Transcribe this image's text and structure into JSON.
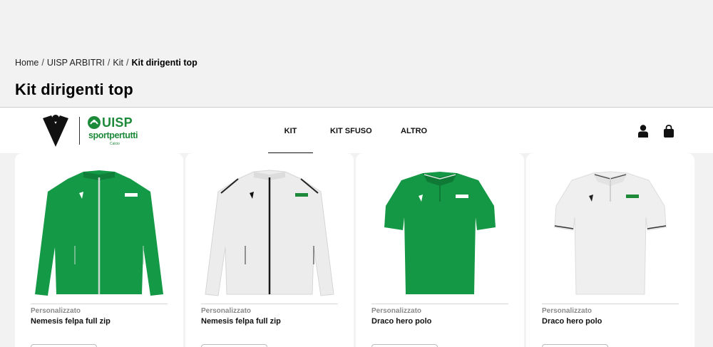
{
  "breadcrumb": {
    "items": [
      "Home",
      "UISP ARBITRI",
      "Kit"
    ],
    "separator": "/",
    "current": "Kit dirigenti top"
  },
  "page": {
    "title": "Kit dirigenti top"
  },
  "brand": {
    "uisp_word": "UISP",
    "uisp_tagline": "sportpertutti",
    "uisp_sub": "Calcio",
    "accent_green": "#1d8a3a"
  },
  "nav": {
    "items": [
      {
        "label": "KIT",
        "active": true
      },
      {
        "label": "KIT SFUSO",
        "active": false
      },
      {
        "label": "ALTRO",
        "active": false
      }
    ]
  },
  "header_icons": [
    "user-icon",
    "shopping-bag-icon"
  ],
  "products": [
    {
      "category": "Personalizzato",
      "name": "Nemesis felpa full zip",
      "color": "green",
      "type": "jacket"
    },
    {
      "category": "Personalizzato",
      "name": "Nemesis felpa full zip",
      "color": "white",
      "type": "jacket"
    },
    {
      "category": "Personalizzato",
      "name": "Draco hero polo",
      "color": "green",
      "type": "polo"
    },
    {
      "category": "Personalizzato",
      "name": "Draco hero polo",
      "color": "white",
      "type": "polo"
    }
  ]
}
